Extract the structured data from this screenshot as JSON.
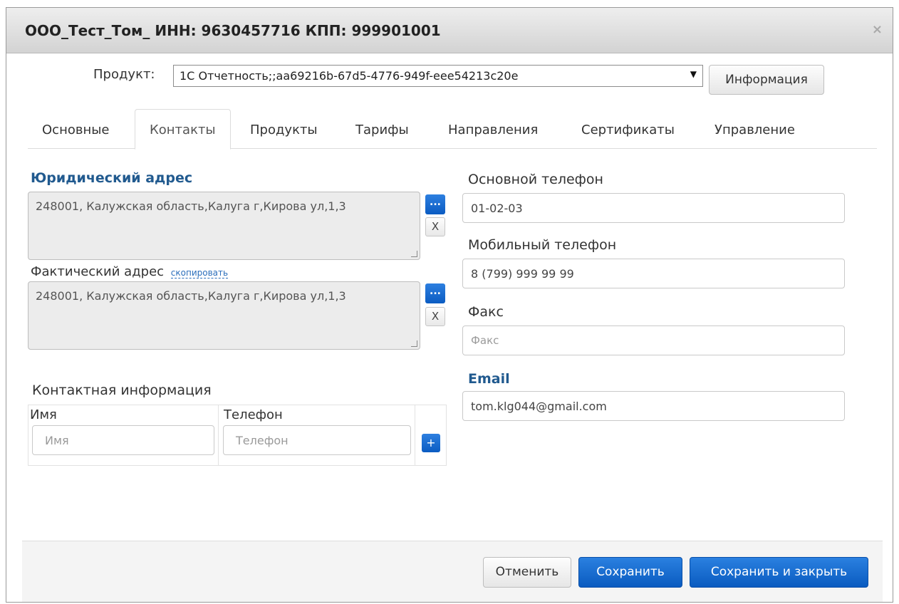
{
  "window": {
    "title": "ООО_Тест_Том_ ИНН: 9630457716 КПП: 999901001",
    "close_glyph": "×"
  },
  "product": {
    "label": "Продукт:",
    "selected": "1С Отчетность;;aa69216b-67d5-4776-949f-eee54213c20e",
    "arrow": "▼",
    "info_button": "Информация"
  },
  "tabs": [
    {
      "label": "Основные"
    },
    {
      "label": "Контакты",
      "active": true
    },
    {
      "label": "Продукты"
    },
    {
      "label": "Тарифы"
    },
    {
      "label": "Направления"
    },
    {
      "label": "Сертификаты"
    },
    {
      "label": "Управление"
    }
  ],
  "legal_address": {
    "title": "Юридический адрес",
    "value": "248001, Калужская область,Калуга г,Кирова ул,1,3",
    "select_button": "...",
    "clear_button": "X"
  },
  "actual_address": {
    "title": "Фактический адрес",
    "copy_link": "скопировать",
    "value": "248001, Калужская область,Калуга г,Кирова ул,1,3",
    "select_button": "...",
    "clear_button": "X"
  },
  "contacts": {
    "title": "Контактная информация",
    "name_header": "Имя",
    "phone_header": "Телефон",
    "name_placeholder": "Имя",
    "phone_placeholder": "Телефон",
    "add_button": "+"
  },
  "main_phone": {
    "label": "Основной телефон",
    "value": "01-02-03"
  },
  "mobile_phone": {
    "label": "Мобильный телефон",
    "value": "8 (799) 999 99 99"
  },
  "fax": {
    "label": "Факс",
    "placeholder": "Факс"
  },
  "email": {
    "label": "Email",
    "value": "tom.klg044@gmail.com"
  },
  "footer": {
    "cancel": "Отменить",
    "save": "Сохранить",
    "save_close": "Сохранить и закрыть"
  },
  "colors": {
    "accent": "#0b5cc2",
    "section_title": "#215a8f"
  }
}
